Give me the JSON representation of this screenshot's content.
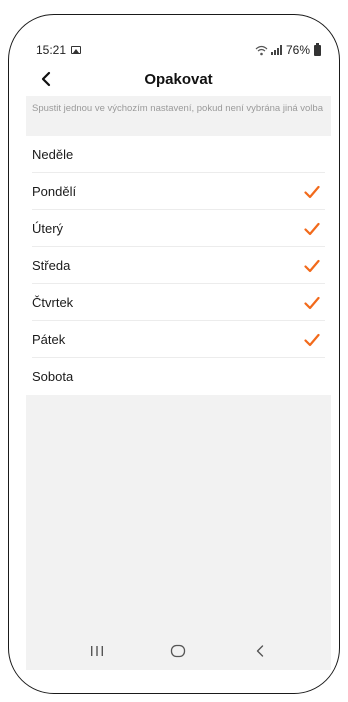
{
  "status_bar": {
    "time": "15:21",
    "battery": "76%",
    "icons": [
      "gallery-icon",
      "wifi-icon",
      "signal-icon",
      "battery-icon"
    ]
  },
  "header": {
    "title": "Opakovat",
    "back_icon": "chevron-left-icon"
  },
  "hint": "Spustit jednou ve výchozím nastavení, pokud není vybrána jiná volba",
  "days": [
    {
      "label": "Neděle",
      "checked": false
    },
    {
      "label": "Pondělí",
      "checked": true
    },
    {
      "label": "Úterý",
      "checked": true
    },
    {
      "label": "Středa",
      "checked": true
    },
    {
      "label": "Čtvrtek",
      "checked": true
    },
    {
      "label": "Pátek",
      "checked": true
    },
    {
      "label": "Sobota",
      "checked": false
    }
  ],
  "colors": {
    "accent": "#f26a1b",
    "background": "#f2f2f2",
    "surface": "#ffffff"
  },
  "nav_bar": {
    "icons": [
      "recent-apps-icon",
      "home-icon",
      "back-icon"
    ]
  }
}
